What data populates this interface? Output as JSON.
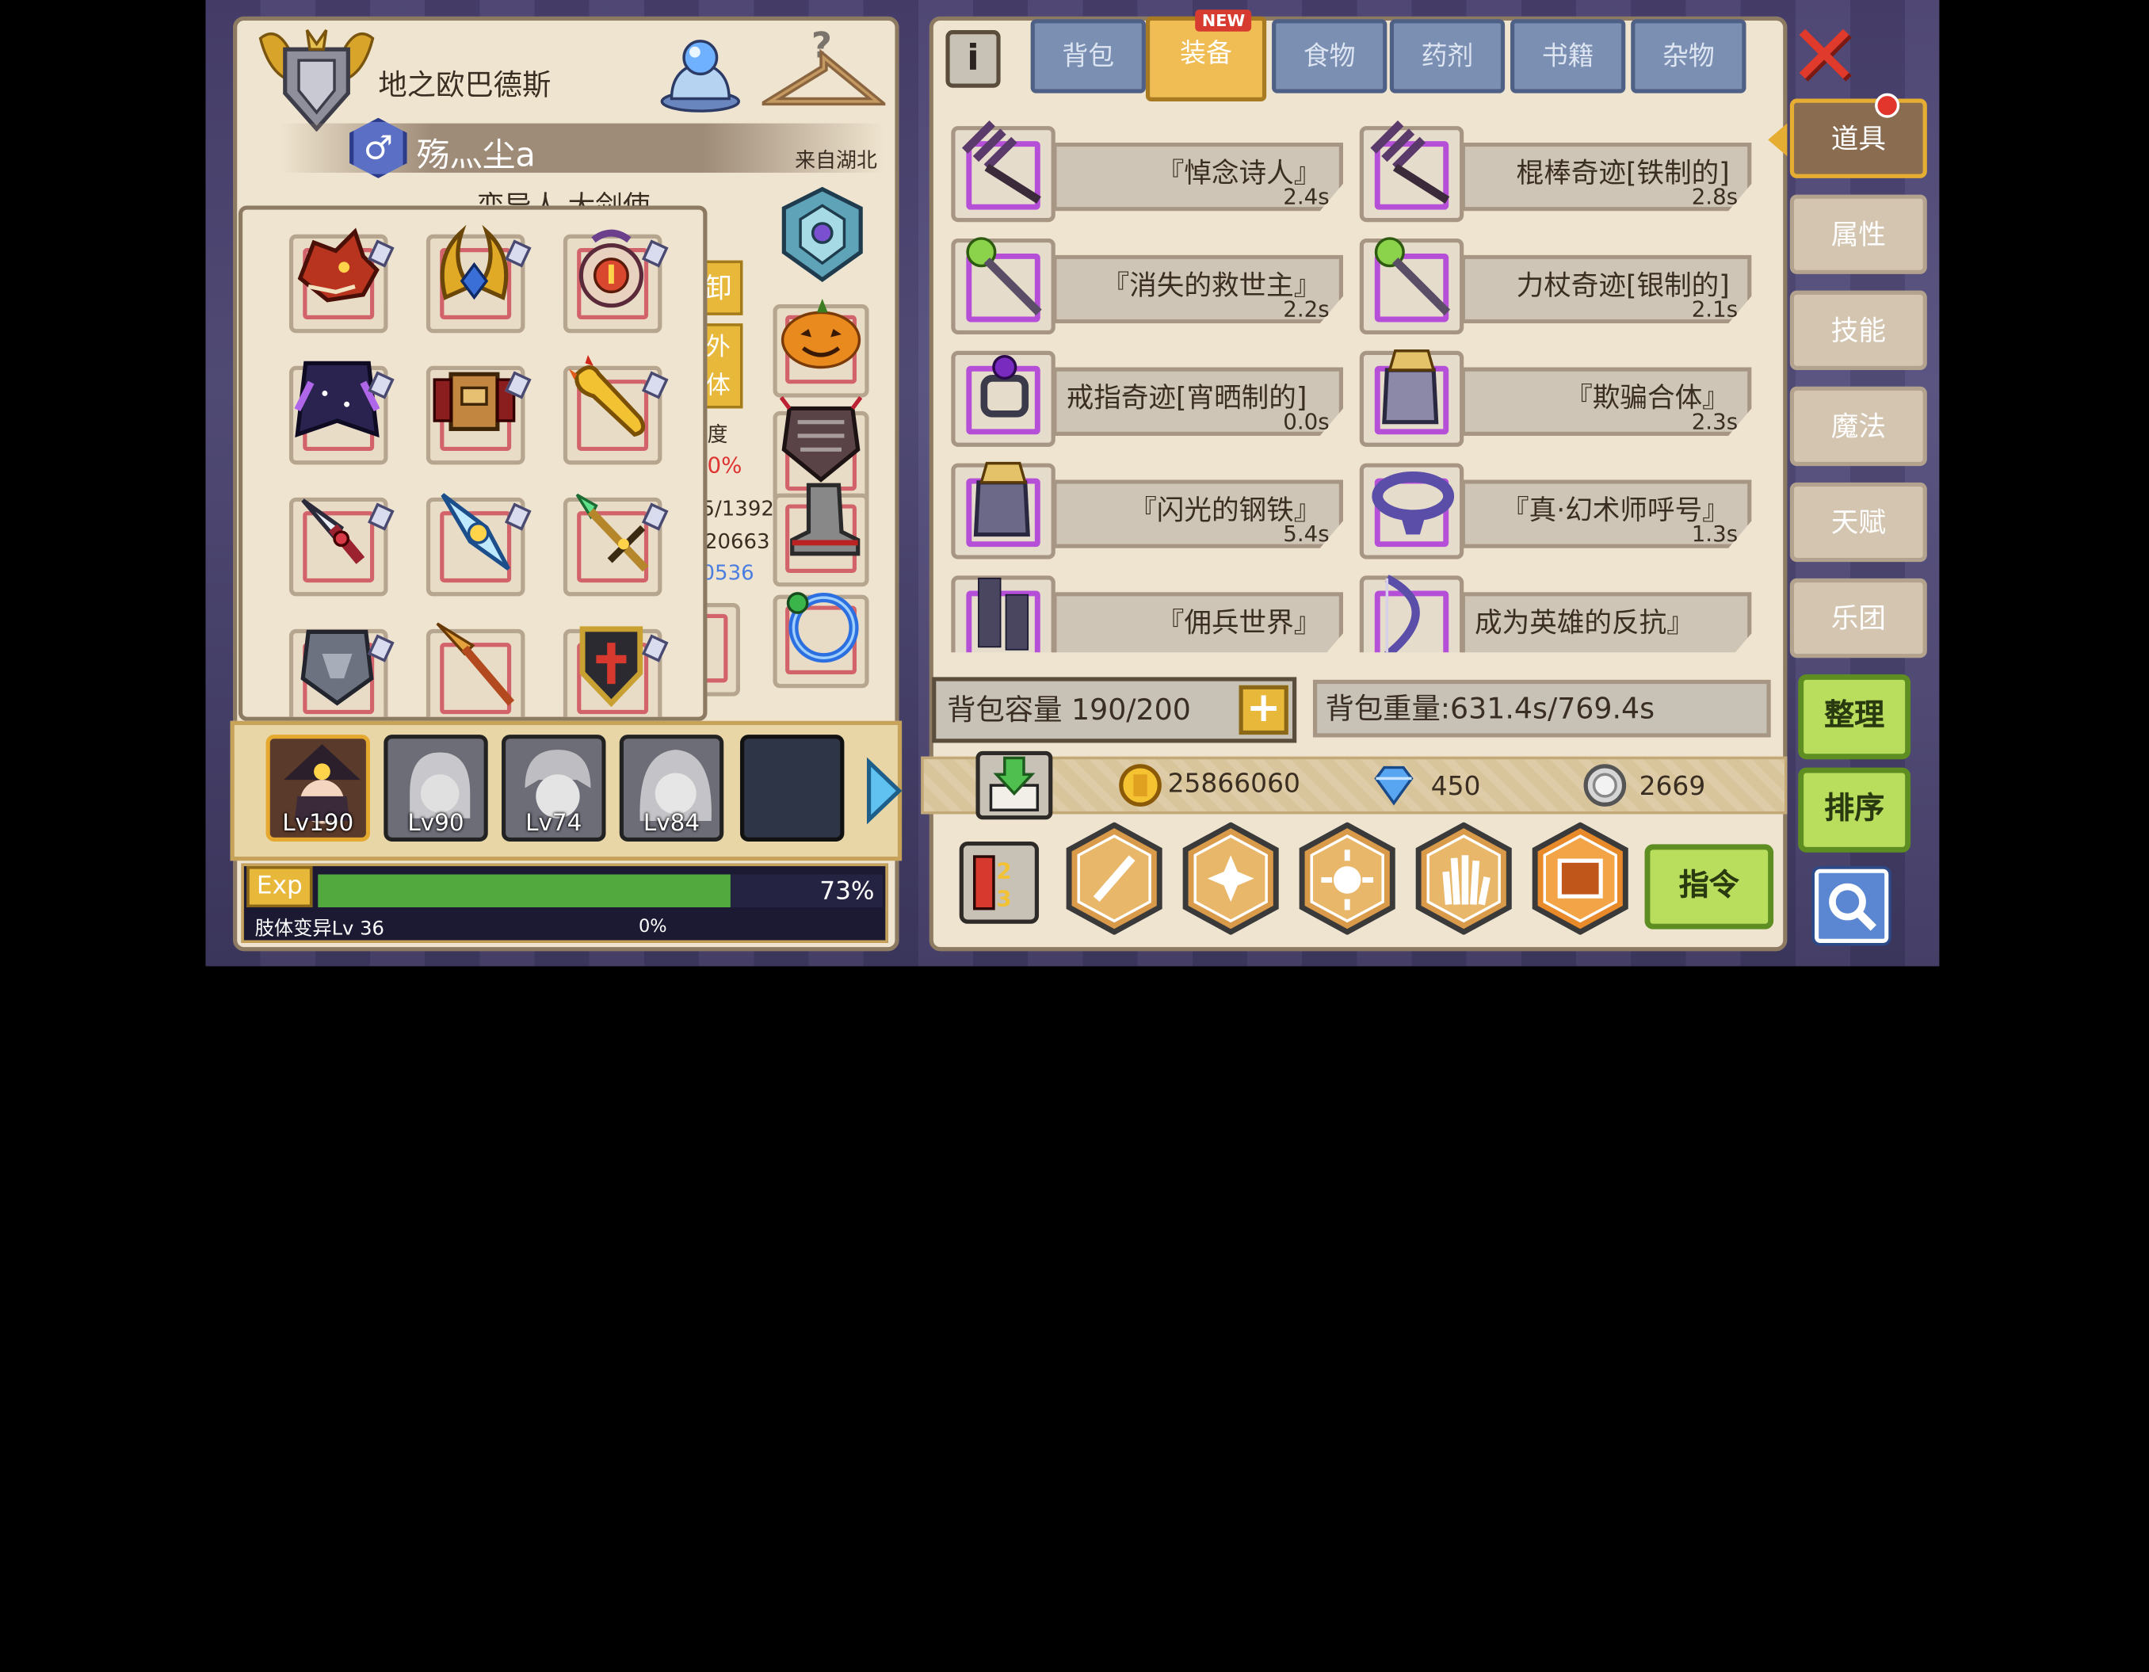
{
  "character": {
    "title": "地之欧巴德斯",
    "name": "殇灬尘a",
    "gender_symbol": "♂",
    "origin": "来自湖北",
    "subtitle": "变异人 大剑使",
    "partial_stats": [
      "卸",
      "外体",
      "度",
      "0%",
      "5/1392",
      "20663",
      "0536"
    ]
  },
  "party": {
    "members": [
      {
        "level": "Lv190"
      },
      {
        "level": "Lv90"
      },
      {
        "level": "Lv74"
      },
      {
        "level": "Lv84"
      }
    ]
  },
  "exp": {
    "badge": "Exp",
    "percent_text": "73%",
    "fill_fraction": 0.73,
    "mutation_label": "肢体变异Lv 36",
    "mutation_percent": "0%"
  },
  "tabs": {
    "items": [
      "背包",
      "装备",
      "食物",
      "药剂",
      "书籍",
      "杂物"
    ],
    "active_index": 1,
    "new_badge": "NEW"
  },
  "side_tabs": {
    "items": [
      "道具",
      "属性",
      "技能",
      "魔法",
      "天赋",
      "乐团"
    ],
    "active_index": 0
  },
  "items": [
    {
      "name": "『悼念诗人』",
      "weight": "2.4s"
    },
    {
      "name": "棍棒奇迹[铁制的]",
      "weight": "2.8s"
    },
    {
      "name": "『消失的救世主』",
      "weight": "2.2s"
    },
    {
      "name": "力杖奇迹[银制的]",
      "weight": "2.1s"
    },
    {
      "name": "戒指奇迹[宵晒制的]",
      "weight": "0.0s"
    },
    {
      "name": "『欺骗合体』",
      "weight": "2.3s"
    },
    {
      "name": "『闪光的钢铁』",
      "weight": "5.4s"
    },
    {
      "name": "『真·幻术师呼号』",
      "weight": "1.3s"
    },
    {
      "name": "『佣兵世界』",
      "weight": ""
    },
    {
      "name": "成为英雄的反抗』",
      "weight": ""
    }
  ],
  "bag": {
    "capacity_text": "背包容量 190/200",
    "weight_text": "背包重量:631.4s/769.4s"
  },
  "currency": {
    "gold": "25866060",
    "diamond": "450",
    "silver": "2669"
  },
  "buttons": {
    "command": "指令",
    "organize": "整理",
    "sort": "排序"
  },
  "colors": {
    "panel_bg": "#efe4cf",
    "tab_active": "#f0bd55",
    "tab_inactive": "#7b8fb2",
    "item_rarity": "#b64fd8",
    "equip_border": "#d2636b",
    "green_button": "#b9dd5c",
    "exp_fill": "#52a93e"
  }
}
